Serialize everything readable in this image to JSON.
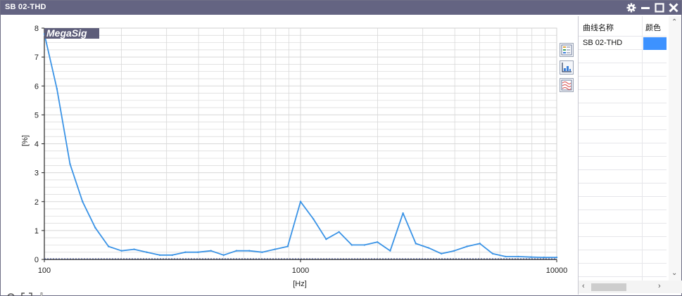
{
  "window": {
    "title": "SB 02-THD",
    "controls": [
      "gear-icon",
      "minimize-icon",
      "maximize-icon",
      "close-icon"
    ]
  },
  "watermark": "MegaSig",
  "legend": {
    "header_name": "曲线名称",
    "header_color": "颜色",
    "items": [
      {
        "name": "SB 02-THD",
        "color": "#3d92ff"
      }
    ]
  },
  "toolbar": {
    "side": [
      "legend-toggle-icon",
      "axis-settings-icon",
      "curve-overlay-icon"
    ],
    "bottom": [
      "zoom-in-icon",
      "fit-to-view-icon",
      "crosshair-icon"
    ]
  },
  "colors": {
    "title_bar": "#646482",
    "series_line": "#3a93e6",
    "grid": "#d8d8d8",
    "axis": "#222222"
  },
  "chart_data": {
    "type": "line",
    "xlabel": "[Hz]",
    "ylabel": "[%]",
    "xscale": "log",
    "xlim": [
      100,
      10000
    ],
    "ylim": [
      0,
      8
    ],
    "x_tick_labels": [
      "100",
      "1000",
      "10000"
    ],
    "y_tick_labels": [
      "0",
      "1",
      "2",
      "3",
      "4",
      "5",
      "6",
      "7",
      "8"
    ],
    "grid": true,
    "legend_position": "right-panel",
    "series": [
      {
        "name": "SB 02-THD",
        "color": "#3a93e6",
        "x": [
          100,
          112,
          126,
          141,
          158,
          178,
          200,
          224,
          251,
          282,
          316,
          355,
          398,
          447,
          501,
          562,
          631,
          708,
          794,
          891,
          1000,
          1122,
          1259,
          1413,
          1585,
          1778,
          1995,
          2239,
          2512,
          2818,
          3162,
          3548,
          3981,
          4467,
          5012,
          5623,
          6310,
          7079,
          7943,
          8913,
          10000
        ],
        "y": [
          7.8,
          5.9,
          3.3,
          2.0,
          1.1,
          0.45,
          0.3,
          0.35,
          0.25,
          0.15,
          0.15,
          0.25,
          0.25,
          0.3,
          0.15,
          0.3,
          0.3,
          0.25,
          0.35,
          0.45,
          2.0,
          1.4,
          0.7,
          0.95,
          0.5,
          0.5,
          0.6,
          0.3,
          1.6,
          0.55,
          0.4,
          0.2,
          0.3,
          0.45,
          0.55,
          0.2,
          0.1,
          0.1,
          0.08,
          0.07,
          0.07
        ]
      }
    ]
  }
}
